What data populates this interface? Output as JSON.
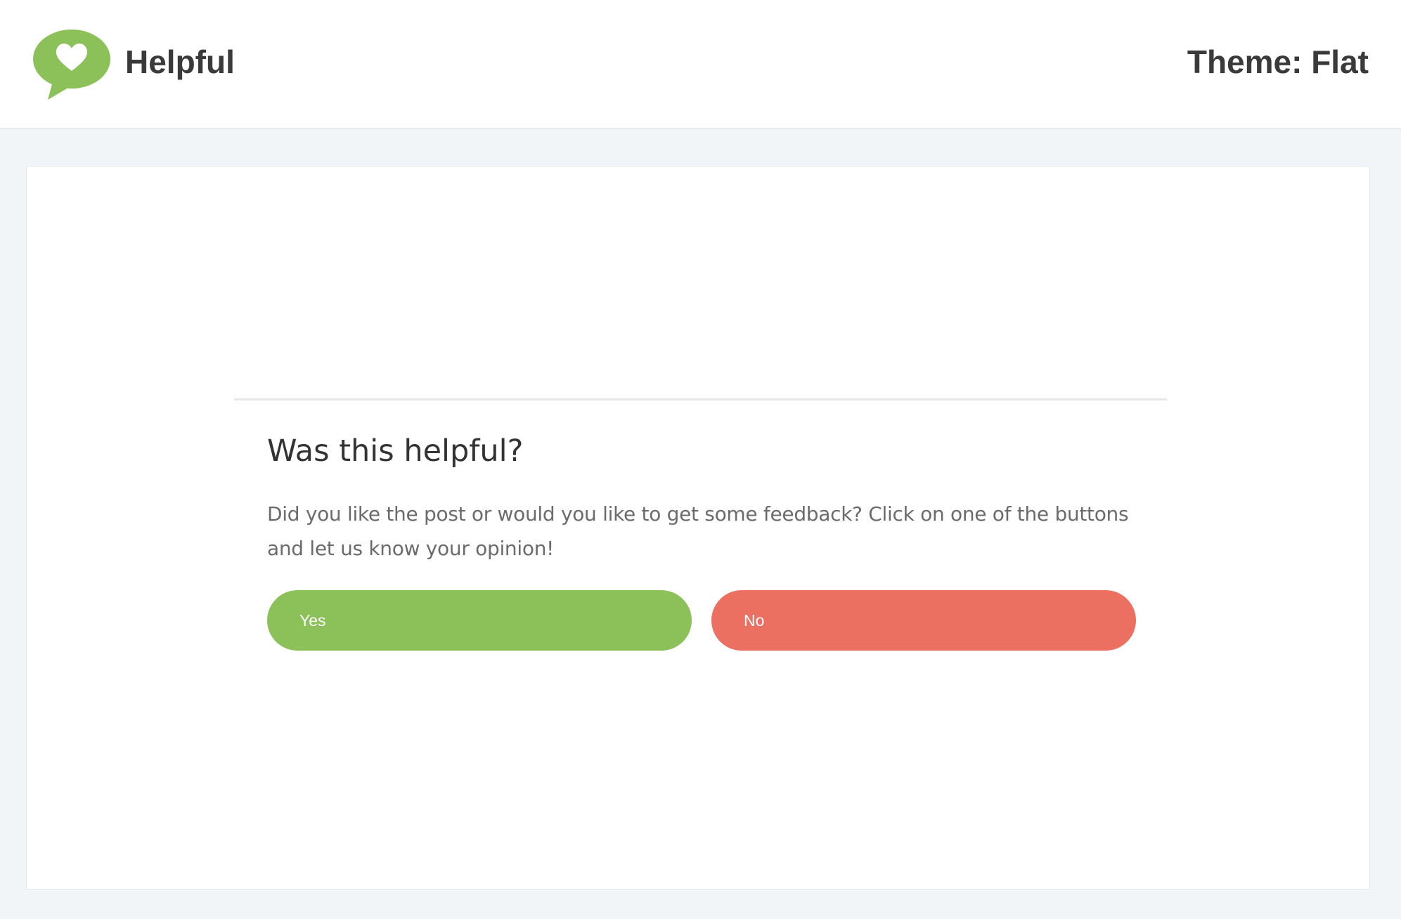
{
  "header": {
    "brand": "Helpful",
    "theme_label": "Theme: Flat",
    "logo_icon": "heart-speech-bubble-icon"
  },
  "widget": {
    "heading": "Was this helpful?",
    "content": "Did you like the post or would you like to get some feedback? Click on one of the buttons and let us know your opinion!",
    "yes_label": "Yes",
    "no_label": "No"
  },
  "colors": {
    "brand_green": "#8bc158",
    "no_red": "#ec7061",
    "page_bg": "#f2f5f7",
    "text_dark": "#3a3a3a"
  }
}
